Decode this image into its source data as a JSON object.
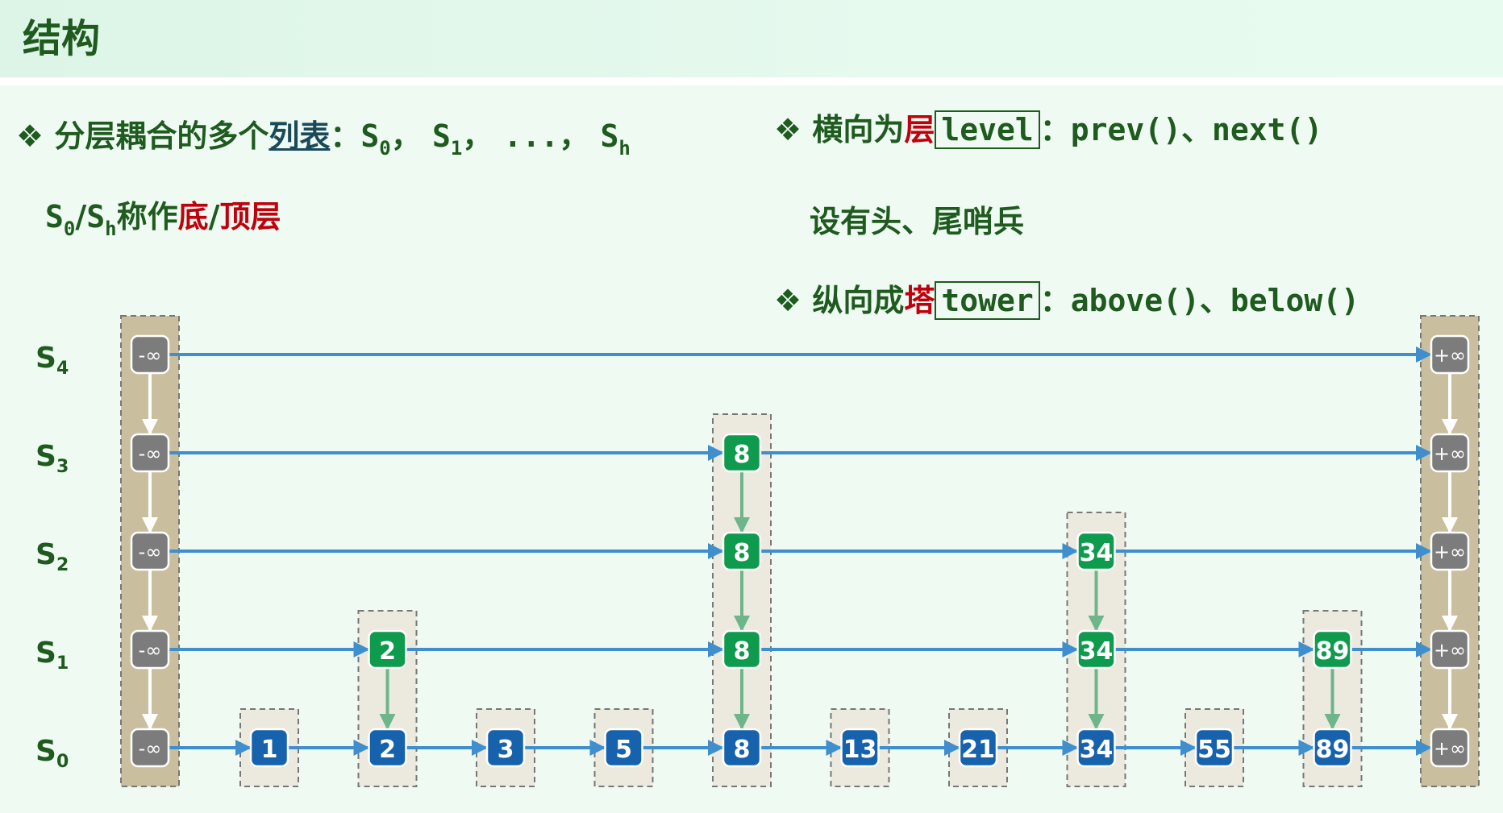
{
  "header": {
    "title": "结构"
  },
  "bullets": {
    "left": {
      "marker": "❖",
      "prefix": "分层耦合的多个",
      "underlined": "列表",
      "colon": "：",
      "s": "S",
      "sub0": "0",
      "sep": "，",
      "sub1": "1",
      "ellipsis": "...",
      "subh": "h",
      "line2_s0": "S",
      "line2_sub0": "0",
      "line2_slash": "/",
      "line2_sh": "S",
      "line2_subh": "h",
      "line2_mid": "称作",
      "line2_bottom": "底",
      "line2_slash2": "/",
      "line2_top": "顶层"
    },
    "right1": {
      "marker": "❖",
      "prefix": "横向为",
      "red": "层",
      "code": "level",
      "rest": "：prev()、next()"
    },
    "right2": {
      "text": "设有头、尾哨兵"
    },
    "right3": {
      "marker": "❖",
      "prefix": "纵向成",
      "red": "塔",
      "code": "tower",
      "rest": "：above()、below()"
    }
  },
  "levels": [
    {
      "s": "S",
      "sub": "4"
    },
    {
      "s": "S",
      "sub": "3"
    },
    {
      "s": "S",
      "sub": "2"
    },
    {
      "s": "S",
      "sub": "1"
    },
    {
      "s": "S",
      "sub": "0"
    }
  ],
  "skiplist": {
    "head_label": "-∞",
    "tail_label": "+∞",
    "towers": [
      {
        "key": "1",
        "height": 1
      },
      {
        "key": "2",
        "height": 2
      },
      {
        "key": "3",
        "height": 1
      },
      {
        "key": "5",
        "height": 1
      },
      {
        "key": "8",
        "height": 4
      },
      {
        "key": "13",
        "height": 1
      },
      {
        "key": "21",
        "height": 1
      },
      {
        "key": "34",
        "height": 3
      },
      {
        "key": "55",
        "height": 1
      },
      {
        "key": "89",
        "height": 2
      }
    ],
    "colors": {
      "bottom_node": "#1762ad",
      "upper_node": "#0f9b4d",
      "sentinel_node": "#7c7c7c",
      "sentinel_tower": "#c9bf9e",
      "tower_bg": "#ece9df",
      "h_arrow": "#3f8fcf",
      "v_arrow_green": "#6db58a",
      "v_arrow_white": "#ffffff"
    }
  }
}
